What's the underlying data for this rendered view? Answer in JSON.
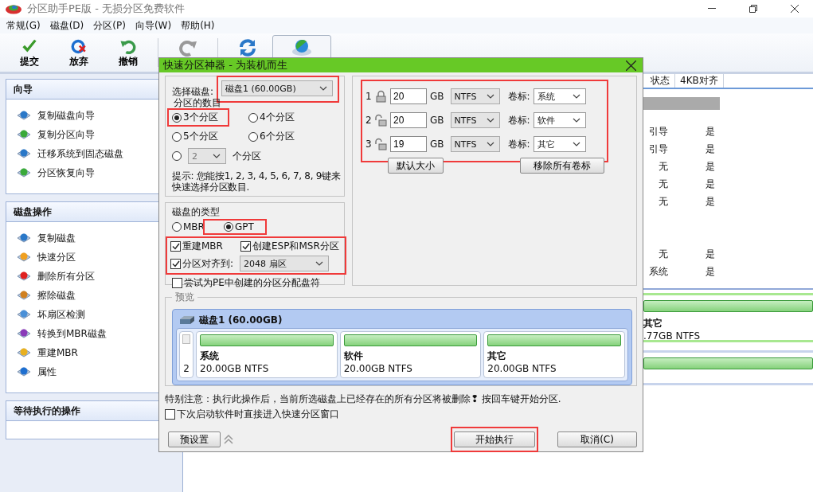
{
  "window": {
    "title": "分区助手PE版 - 无损分区免费软件"
  },
  "menu": [
    "常规(G)",
    "磁盘(D)",
    "分区(P)",
    "向导(W)",
    "帮助(H)"
  ],
  "toolbar": [
    {
      "kind": "commit",
      "label": "提交",
      "framed": false
    },
    {
      "kind": "discard",
      "label": "放弃",
      "framed": false
    },
    {
      "kind": "undo",
      "label": "撤销",
      "framed": false
    },
    {
      "kind": "redo",
      "framed": false
    },
    {
      "kind": "refresh",
      "framed": false
    },
    {
      "kind": "quick",
      "framed": true
    }
  ],
  "sidebar": [
    {
      "title": "向导",
      "items": [
        {
          "kind": "copy-disk",
          "label": "复制磁盘向导"
        },
        {
          "kind": "copy-part",
          "label": "复制分区向导"
        },
        {
          "kind": "migrate",
          "label": "迁移系统到固态磁盘"
        },
        {
          "kind": "recover",
          "label": "分区恢复向导"
        }
      ]
    },
    {
      "title": "磁盘操作",
      "items": [
        {
          "kind": "copy-disk",
          "label": "复制磁盘"
        },
        {
          "kind": "quick",
          "label": "快速分区"
        },
        {
          "kind": "delete",
          "label": "删除所有分区"
        },
        {
          "kind": "wipe",
          "label": "擦除磁盘"
        },
        {
          "kind": "scan",
          "label": "坏扇区检测"
        },
        {
          "kind": "convert",
          "label": "转换到MBR磁盘"
        },
        {
          "kind": "rebuild",
          "label": "重建MBR"
        },
        {
          "kind": "info",
          "label": "属性"
        }
      ]
    },
    {
      "title": "等待执行的操作"
    }
  ],
  "table": {
    "columns": [
      "状态",
      "4KB对齐"
    ],
    "rows": [
      {
        "kind": "disk"
      },
      {
        "kind": "partition",
        "status": "引导",
        "aligned": "是"
      },
      {
        "kind": "partition",
        "status": "引导",
        "aligned": "是"
      },
      {
        "kind": "partition",
        "status": "无",
        "aligned": "是"
      },
      {
        "kind": "partition",
        "status": "无",
        "aligned": "是"
      },
      {
        "kind": "partition",
        "status": "无",
        "aligned": "是"
      },
      {
        "kind": "blank"
      },
      {
        "kind": "blank"
      },
      {
        "kind": "partition",
        "status": "无",
        "aligned": "是"
      },
      {
        "kind": "partition",
        "status": "系统",
        "aligned": "是"
      }
    ]
  },
  "disk_map": [
    {
      "kind": "card",
      "name": "其它",
      "info": ".77GB NTFS"
    },
    {
      "kind": "bar"
    }
  ],
  "dialog": {
    "title": "快速分区神器 - 为装机而生",
    "disk_select": {
      "label": "选择磁盘:",
      "value": "磁盘1 (60.00GB)",
      "highlighted": true
    },
    "count_label": "分区的数目",
    "count_options": [
      {
        "label": "3个分区",
        "selected": true,
        "highlighted": true
      },
      {
        "label": "4个分区",
        "selected": false,
        "highlighted": false
      },
      {
        "label": "5个分区",
        "selected": false,
        "highlighted": false
      },
      {
        "label": "6个分区",
        "selected": false,
        "highlighted": false
      }
    ],
    "custom_count": {
      "value": "2",
      "suffix": "个分区",
      "selected": false
    },
    "hint": "提示: 您能按1, 2, 3, 4, 5, 6, 7, 8, 9键来快速选择分区数目.",
    "disk_type": {
      "label": "磁盘的类型",
      "options": [
        {
          "label": "MBR",
          "selected": false,
          "highlighted": false
        },
        {
          "label": "GPT",
          "selected": true,
          "highlighted": true
        }
      ]
    },
    "checks": {
      "highlighted": true,
      "items": [
        {
          "label": "重建MBR",
          "checked": true
        },
        {
          "label": "创建ESP和MSR分区",
          "checked": true
        },
        {
          "label": "分区对齐到:",
          "checked": true,
          "select": "2048 扇区"
        }
      ]
    },
    "assign_letters": {
      "label": "尝试为PE中创建的分区分配盘符",
      "checked": false
    },
    "partitions_highlighted": true,
    "partitions": [
      {
        "number": "1",
        "locked": true,
        "size": "20",
        "unit": "GB",
        "fs": "NTFS",
        "caption": "卷标:",
        "label": "系统"
      },
      {
        "number": "2",
        "locked": false,
        "size": "20",
        "unit": "GB",
        "fs": "NTFS",
        "caption": "卷标:",
        "label": "软件"
      },
      {
        "number": "3",
        "locked": false,
        "size": "19",
        "unit": "GB",
        "fs": "NTFS",
        "caption": "卷标:",
        "label": "其它"
      }
    ],
    "size_buttons": [
      "默认大小",
      "移除所有卷标"
    ],
    "preview": {
      "legend": "预览",
      "disk": "磁盘1 (60.00GB)",
      "index": "2",
      "parts": [
        {
          "name": "系统",
          "info": "20.00GB NTFS"
        },
        {
          "name": "软件",
          "info": "20.00GB NTFS"
        },
        {
          "name": "其它",
          "info": "20.00GB NTFS"
        }
      ]
    },
    "warning": "特别注意：执行此操作后，当前所选磁盘上已经存在的所有分区将被删除❢ 按回车键开始分区.",
    "remember": {
      "label": "下次启动软件时直接进入快速分区窗口",
      "checked": false
    },
    "preset": "预设置",
    "start": {
      "label": "开始执行",
      "highlighted": true
    },
    "cancel": "取消(C)"
  }
}
